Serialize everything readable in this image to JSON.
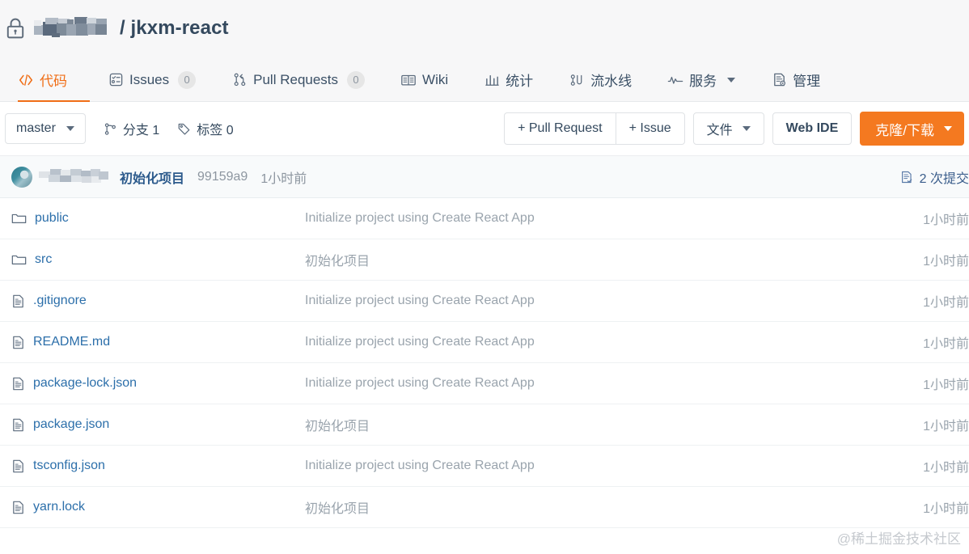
{
  "repo": {
    "visibility_icon": "lock-icon",
    "owner_masked": true,
    "separator_and_name": "/ jkxm-react"
  },
  "tabs": [
    {
      "label": "代码",
      "icon": "code-icon",
      "active": true,
      "badge": null,
      "dropdown": false
    },
    {
      "label": "Issues",
      "icon": "issue-icon",
      "active": false,
      "badge": "0",
      "dropdown": false
    },
    {
      "label": "Pull Requests",
      "icon": "pull-request-icon",
      "active": false,
      "badge": "0",
      "dropdown": false
    },
    {
      "label": "Wiki",
      "icon": "wiki-icon",
      "active": false,
      "badge": null,
      "dropdown": false
    },
    {
      "label": "统计",
      "icon": "chart-icon",
      "active": false,
      "badge": null,
      "dropdown": false
    },
    {
      "label": "流水线",
      "icon": "pipeline-icon",
      "active": false,
      "badge": null,
      "dropdown": false
    },
    {
      "label": "服务",
      "icon": "activity-icon",
      "active": false,
      "badge": null,
      "dropdown": true
    },
    {
      "label": "管理",
      "icon": "settings-doc-icon",
      "active": false,
      "badge": null,
      "dropdown": false
    }
  ],
  "toolbar": {
    "branch_selector": "master",
    "branches_label": "分支 1",
    "tags_label": "标签 0",
    "new_pull_request": "+ Pull Request",
    "new_issue": "+ Issue",
    "files_menu": "文件",
    "web_ide": "Web IDE",
    "clone_download": "克隆/下载"
  },
  "latest_commit": {
    "author_masked": true,
    "message": "初始化项目",
    "sha": "99159a9",
    "time": "1小时前",
    "commits_count_label": "2 次提交"
  },
  "files": [
    {
      "name": "public",
      "type": "folder",
      "message": "Initialize project using Create React App",
      "time": "1小时前"
    },
    {
      "name": "src",
      "type": "folder",
      "message": "初始化项目",
      "time": "1小时前"
    },
    {
      "name": ".gitignore",
      "type": "file",
      "message": "Initialize project using Create React App",
      "time": "1小时前"
    },
    {
      "name": "README.md",
      "type": "file",
      "message": "Initialize project using Create React App",
      "time": "1小时前"
    },
    {
      "name": "package-lock.json",
      "type": "file",
      "message": "Initialize project using Create React App",
      "time": "1小时前"
    },
    {
      "name": "package.json",
      "type": "file",
      "message": "初始化项目",
      "time": "1小时前"
    },
    {
      "name": "tsconfig.json",
      "type": "file",
      "message": "Initialize project using Create React App",
      "time": "1小时前"
    },
    {
      "name": "yarn.lock",
      "type": "file",
      "message": "初始化项目",
      "time": "1小时前"
    }
  ],
  "watermark": "@稀土掘金技术社区",
  "colors": {
    "accent_orange": "#f47920",
    "active_tab": "#f06e17",
    "link_blue": "#2c6faa",
    "muted_text": "#9aa4ad",
    "header_bg": "#f7f7f8"
  }
}
